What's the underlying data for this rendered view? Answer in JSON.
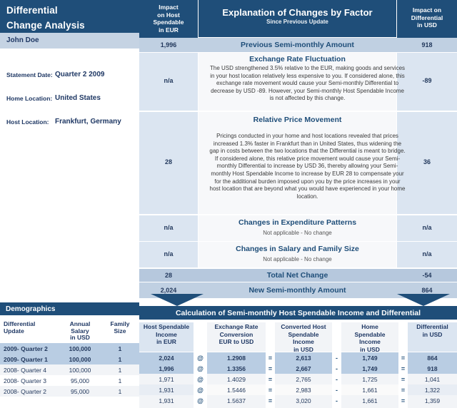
{
  "report": {
    "title_line1": "Differential",
    "title_line2": "Change Analysis",
    "employee_name": "John Doe",
    "info": [
      {
        "label": "Statement Date:",
        "value": "Quarter 2 2009"
      },
      {
        "label": "Home Location:",
        "value": "United States"
      },
      {
        "label": "Host Location:",
        "value": "Frankfurt, Germany"
      }
    ]
  },
  "explanation": {
    "header": {
      "left": "Impact on Host Spendable in EUR",
      "left_lines": [
        "Impact",
        "on Host",
        "Spendable",
        "in EUR"
      ],
      "center_title": "Explanation of Changes by Factor",
      "center_sub": "Since Previous Update",
      "right_lines": [
        "Impact on",
        "Differential",
        "in USD"
      ]
    },
    "rows": [
      {
        "impact_host": "1,996",
        "title": "Previous Semi-monthly Amount",
        "body": "",
        "impact_diff": "918",
        "style": "band"
      },
      {
        "impact_host": "n/a",
        "title": "Exchange Rate Fluctuation",
        "body": "The USD strengthened 3.5% relative to the EUR, making goods and services in your host location relatively less expensive to you.  If considered alone, this exchange rate movement would cause your Semi-monthly Differential to decrease by USD -89.  However, your Semi-monthly Host Spendable Income is not affected by this change.",
        "impact_diff": "-89",
        "style": "soft"
      },
      {
        "impact_host": "28",
        "title": "Relative Price Movement",
        "body": "Pricings conducted in your home and host locations revealed that prices increased  1.3% faster in Frankfurt than in United States, thus widening the gap in costs between the two locations that the Differential is meant to bridge.  If considered alone, this relative price movement would cause your Semi-monthly Differential to increase by USD 36, thereby allowing your Semi-monthly Host Spendable Income to increase by EUR 28 to compensate your for the additional burden imposed upon you by the price increases in your host location that are beyond what you would have experienced in your home location.",
        "impact_diff": "36",
        "style": "soft"
      },
      {
        "impact_host": "n/a",
        "title": "Changes in Expenditure Patterns",
        "body": "Not applicable - No change",
        "impact_diff": "n/a",
        "style": "soft"
      },
      {
        "impact_host": "n/a",
        "title": "Changes in Salary and Family Size",
        "body": "Not applicable - No change",
        "impact_diff": "n/a",
        "style": "soft"
      },
      {
        "impact_host": "28",
        "title": "Total Net Change",
        "body": "",
        "impact_diff": "-54",
        "style": "total"
      },
      {
        "impact_host": "2,024",
        "title": "New Semi-monthly Amount",
        "body": "",
        "impact_diff": "864",
        "style": "band"
      }
    ]
  },
  "demographics": {
    "title": "Demographics",
    "columns": [
      {
        "lines": [
          "",
          "Differential",
          "Update"
        ]
      },
      {
        "lines": [
          "Annual",
          "Salary",
          "in USD"
        ]
      },
      {
        "lines": [
          "",
          "Family",
          "Size"
        ]
      }
    ],
    "rows": [
      {
        "update": "2009- Quarter 2",
        "salary": "100,000",
        "family": "1",
        "highlight": true
      },
      {
        "update": "2009- Quarter 1",
        "salary": "100,000",
        "family": "1",
        "highlight": true
      },
      {
        "update": "2008- Quarter 4",
        "salary": "100,000",
        "family": "1",
        "highlight": false
      },
      {
        "update": "2008- Quarter 3",
        "salary": "95,000",
        "family": "1",
        "highlight": false
      },
      {
        "update": "2008- Quarter 2",
        "salary": "95,000",
        "family": "1",
        "highlight": false
      }
    ]
  },
  "calculation": {
    "title": "Calculation of Semi-monthly Host Spendable Income and Differential",
    "columns": [
      {
        "lines": [
          "",
          "Host Spendable",
          "Income",
          "in EUR"
        ]
      },
      {
        "lines": [
          "",
          "Exchange Rate",
          "Conversion",
          "EUR to USD"
        ]
      },
      {
        "lines": [
          "Converted Host",
          "Spendable",
          "Income",
          "in USD"
        ]
      },
      {
        "lines": [
          "Home",
          "Spendable",
          "Income",
          "in USD"
        ]
      },
      {
        "lines": [
          "",
          "",
          "Differential",
          "in USD"
        ]
      }
    ],
    "operators": {
      "op1": "@",
      "op2": "=",
      "op3": "-",
      "op4": "="
    },
    "rows": [
      {
        "host_eur": "2,024",
        "rate": "1.2908",
        "converted_usd": "2,613",
        "home_usd": "1,749",
        "differential": "864",
        "highlight": true
      },
      {
        "host_eur": "1,996",
        "rate": "1.3356",
        "converted_usd": "2,667",
        "home_usd": "1,749",
        "differential": "918",
        "highlight": true
      },
      {
        "host_eur": "1,971",
        "rate": "1.4029",
        "converted_usd": "2,765",
        "home_usd": "1,725",
        "differential": "1,041",
        "highlight": false
      },
      {
        "host_eur": "1,931",
        "rate": "1.5446",
        "converted_usd": "2,983",
        "home_usd": "1,661",
        "differential": "1,322",
        "highlight": false
      },
      {
        "host_eur": "1,931",
        "rate": "1.5637",
        "converted_usd": "3,020",
        "home_usd": "1,661",
        "differential": "1,359",
        "highlight": false
      }
    ]
  },
  "colors": {
    "brand_dark": "#1f4e79",
    "band": "#c0d0e2",
    "soft": "#dbe5f1",
    "highlight": "#b9cde3"
  }
}
